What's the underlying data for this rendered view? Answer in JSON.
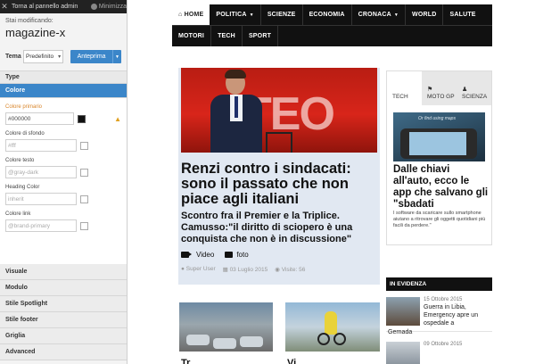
{
  "panel": {
    "back_label": "Torna al pannello admin",
    "close_symbol": "✕",
    "minimize_label": "Minimizza",
    "editing_label": "Stai modificando:",
    "site_name": "magazine-x",
    "theme_label": "Tema",
    "theme_value": "Predefinito",
    "preview_label": "Anteprima",
    "sections_top": [
      "Type",
      "Colore"
    ],
    "fields": [
      {
        "label": "Colore primario",
        "value": "#000000",
        "placeholder": "",
        "accent": true,
        "warning": true
      },
      {
        "label": "Colore di sfondo",
        "value": "",
        "placeholder": "#fff",
        "accent": false,
        "warning": false
      },
      {
        "label": "Colore testo",
        "value": "",
        "placeholder": "@gray-dark",
        "accent": false,
        "warning": false
      },
      {
        "label": "Heading Color",
        "value": "",
        "placeholder": "inherit",
        "accent": false,
        "warning": false
      },
      {
        "label": "Colore link",
        "value": "",
        "placeholder": "@brand-primary",
        "accent": false,
        "warning": false
      }
    ],
    "sections_bottom": [
      "Visuale",
      "Modulo",
      "Stile Spotlight",
      "Stile footer",
      "Griglia",
      "Advanced"
    ]
  },
  "nav": {
    "row1": [
      {
        "label": "HOME",
        "icon": "home-icon",
        "active": true,
        "dropdown": false
      },
      {
        "label": "POLITICA",
        "active": false,
        "dropdown": true
      },
      {
        "label": "SCIENZE",
        "active": false,
        "dropdown": false
      },
      {
        "label": "ECONOMIA",
        "active": false,
        "dropdown": false
      },
      {
        "label": "CRONACA",
        "active": false,
        "dropdown": true
      },
      {
        "label": "WORLD",
        "active": false,
        "dropdown": false
      },
      {
        "label": "SALUTE",
        "active": false,
        "dropdown": false
      }
    ],
    "row2": [
      {
        "label": "MOTORI"
      },
      {
        "label": "TECH"
      },
      {
        "label": "SPORT"
      }
    ]
  },
  "featured": {
    "image_text": "TEO",
    "title": "Renzi contro i sindacati: sono il passato che non piace agli italiani",
    "subtitle": "Scontro fra il Premier e la Triplice. Camusso:\"il diritto di sciopero è una conquista che non è in discussione\"",
    "video_label": "Video",
    "photo_label": "foto",
    "author": "Super User",
    "date": "03 Luglio 2015",
    "views": "Visite: 56"
  },
  "tabs": {
    "items": [
      {
        "label": "TECH",
        "icon": "apple-icon",
        "active": true
      },
      {
        "label": "MOTO GP",
        "icon": "flag-icon",
        "active": false
      },
      {
        "label": "SCIENZA",
        "icon": "user-icon",
        "active": false
      }
    ],
    "image_caption": "Or find using maps",
    "title": "Dalle chiavi all'auto, ecco le app che salvano gli \"sbadati",
    "text": "I software da scaricare sullo smartphone aiutano a ritrovare gli oggetti quotidiani più facili da perdere.\""
  },
  "evidenza": {
    "heading": "IN EVIDENZA",
    "items": [
      {
        "date": "15 Ottobre 2015",
        "title": "Guerra in Libia, Emergency apre un ospedale a"
      },
      {
        "date": "09 Ottobre 2015",
        "title": ""
      }
    ],
    "overflow_text": "Gernada"
  },
  "bottom": {
    "title_left": "Tr",
    "title_right": "Vi"
  }
}
